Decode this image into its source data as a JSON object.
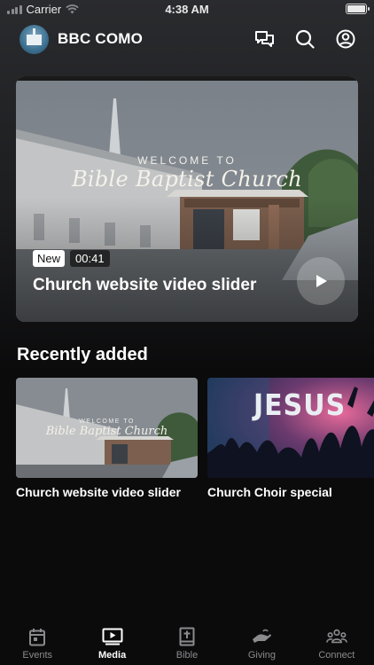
{
  "status_bar": {
    "carrier": "Carrier",
    "time": "4:38 AM"
  },
  "header": {
    "title": "BBC COMO",
    "icons": [
      "chat-icon",
      "search-icon",
      "profile-icon"
    ]
  },
  "hero": {
    "overlay_small": "WELCOME TO",
    "overlay_large": "Bible Baptist Church",
    "badge": "New",
    "duration": "00:41",
    "title": "Church website video slider"
  },
  "recently_added": {
    "heading": "Recently added",
    "items": [
      {
        "title": "Church website video slider",
        "overlay_small": "WELCOME TO",
        "overlay_large": "Bible Baptist Church"
      },
      {
        "title": "Church Choir special",
        "overlay_text": "JESUS"
      }
    ]
  },
  "nav": {
    "items": [
      {
        "label": "Events",
        "icon": "calendar-icon",
        "active": false
      },
      {
        "label": "Media",
        "icon": "media-play-icon",
        "active": true
      },
      {
        "label": "Bible",
        "icon": "bible-icon",
        "active": false
      },
      {
        "label": "Giving",
        "icon": "giving-hand-icon",
        "active": false
      },
      {
        "label": "Connect",
        "icon": "group-icon",
        "active": false
      }
    ]
  },
  "colors": {
    "background": "#0b0b0c",
    "inactive_nav": "#8b8b8e",
    "active_nav": "#ffffff"
  }
}
